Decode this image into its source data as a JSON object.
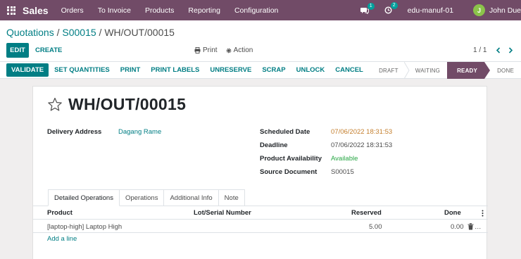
{
  "navbar": {
    "app_name": "Sales",
    "menu": [
      "Orders",
      "To Invoice",
      "Products",
      "Reporting",
      "Configuration"
    ],
    "messages_count": "1",
    "activities_count": "2",
    "company": "edu-manuf-01",
    "user_initial": "J",
    "user_name": "John Due"
  },
  "control_panel": {
    "breadcrumb_1": "Quotations",
    "breadcrumb_sep_1": " / ",
    "breadcrumb_2": "S00015",
    "breadcrumb_sep_2": " / ",
    "breadcrumb_current": "WH/OUT/00015",
    "edit_label": "EDIT",
    "create_label": "CREATE",
    "print_label": "Print",
    "action_label": "Action",
    "pager": "1 / 1"
  },
  "statusbar": {
    "buttons": [
      "VALIDATE",
      "SET QUANTITIES",
      "PRINT",
      "PRINT LABELS",
      "UNRESERVE",
      "SCRAP",
      "UNLOCK",
      "CANCEL"
    ],
    "stages": [
      "DRAFT",
      "WAITING",
      "READY",
      "DONE"
    ],
    "active_stage": "READY"
  },
  "record": {
    "title": "WH/OUT/00015",
    "delivery_address_label": "Delivery Address",
    "delivery_address": "Dagang Rame",
    "scheduled_date_label": "Scheduled Date",
    "scheduled_date": "07/06/2022 18:31:53",
    "deadline_label": "Deadline",
    "deadline": "07/06/2022 18:31:53",
    "availability_label": "Product Availability",
    "availability": "Available",
    "source_label": "Source Document",
    "source": "S00015"
  },
  "tabs": [
    "Detailed Operations",
    "Operations",
    "Additional Info",
    "Note"
  ],
  "table": {
    "headers": {
      "product": "Product",
      "lot": "Lot/Serial Number",
      "reserved": "Reserved",
      "done": "Done"
    },
    "rows": [
      {
        "product": "[laptop-high] Laptop High",
        "reserved": "5.00",
        "done": "0.00"
      }
    ],
    "add_line": "Add a line"
  },
  "colors": {
    "brand": "#714b67",
    "accent": "#017e84",
    "date_warning": "#c47e2c",
    "available": "#28a745"
  }
}
